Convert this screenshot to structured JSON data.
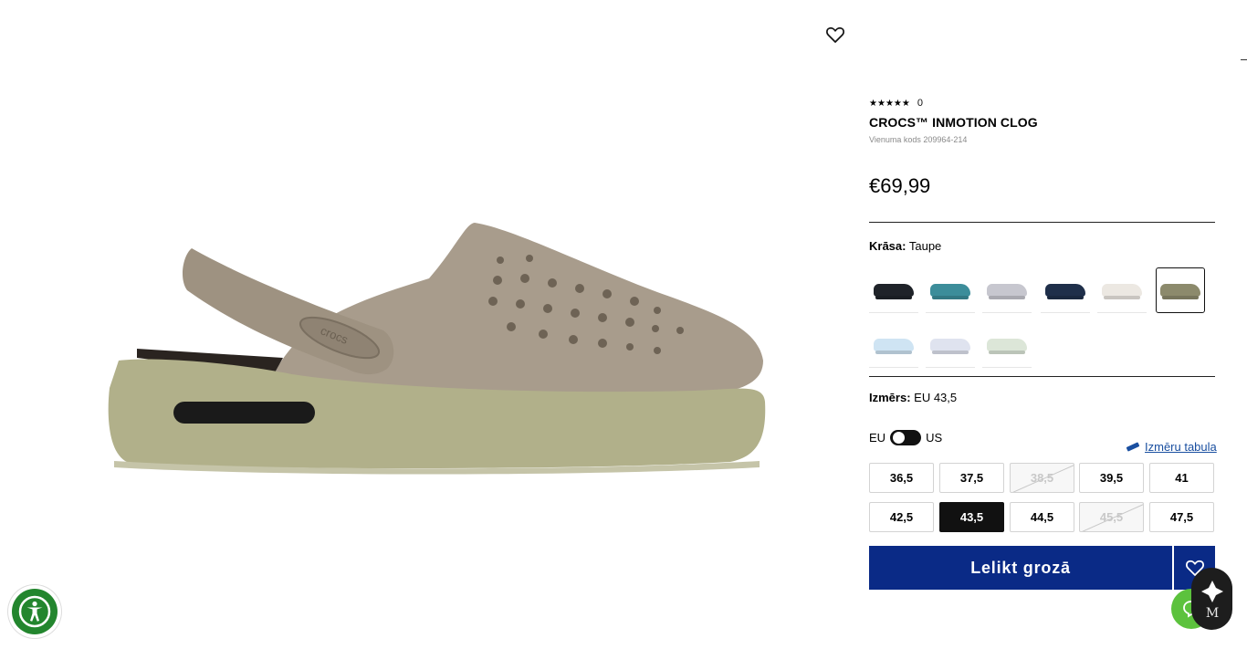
{
  "product": {
    "rating_count": "0",
    "title": "CROCS™ INMOTION CLOG",
    "sku_text": "Vienuma kods 209964-214",
    "price": "€69,99"
  },
  "color": {
    "label": "Krāsa:",
    "value": "Taupe",
    "swatches": [
      {
        "color": "#1f2329",
        "selected": false
      },
      {
        "color": "#3c8d9a",
        "selected": false
      },
      {
        "color": "#c7c7cf",
        "selected": false
      },
      {
        "color": "#1f2f4a",
        "selected": false
      },
      {
        "color": "#ece8e2",
        "selected": false
      },
      {
        "color": "#8c8a6c",
        "selected": true
      },
      {
        "color": "#cfe4f3",
        "selected": false
      },
      {
        "color": "#dfe3ef",
        "selected": false
      },
      {
        "color": "#dce6d8",
        "selected": false
      }
    ]
  },
  "size": {
    "label": "Izmērs:",
    "value": "EU 43,5",
    "toggle_left": "EU",
    "toggle_right": "US",
    "chart_link": "Izmēru tabula",
    "options": [
      {
        "label": "36,5",
        "state": "normal"
      },
      {
        "label": "37,5",
        "state": "normal"
      },
      {
        "label": "38,5",
        "state": "disabled"
      },
      {
        "label": "39,5",
        "state": "normal"
      },
      {
        "label": "41",
        "state": "normal"
      },
      {
        "label": "42,5",
        "state": "normal"
      },
      {
        "label": "43,5",
        "state": "selected"
      },
      {
        "label": "44,5",
        "state": "normal"
      },
      {
        "label": "45,5",
        "state": "disabled"
      },
      {
        "label": "47,5",
        "state": "normal"
      }
    ]
  },
  "cart": {
    "add_label": "Lelikt grozā"
  },
  "badge": {
    "monogram": "M"
  },
  "image": {
    "brand_mark": "crocs"
  },
  "colors": {
    "primary": "#0a2a86",
    "accessibility": "#23862e",
    "chat": "#5cc23d",
    "link": "#1a4fa0"
  }
}
